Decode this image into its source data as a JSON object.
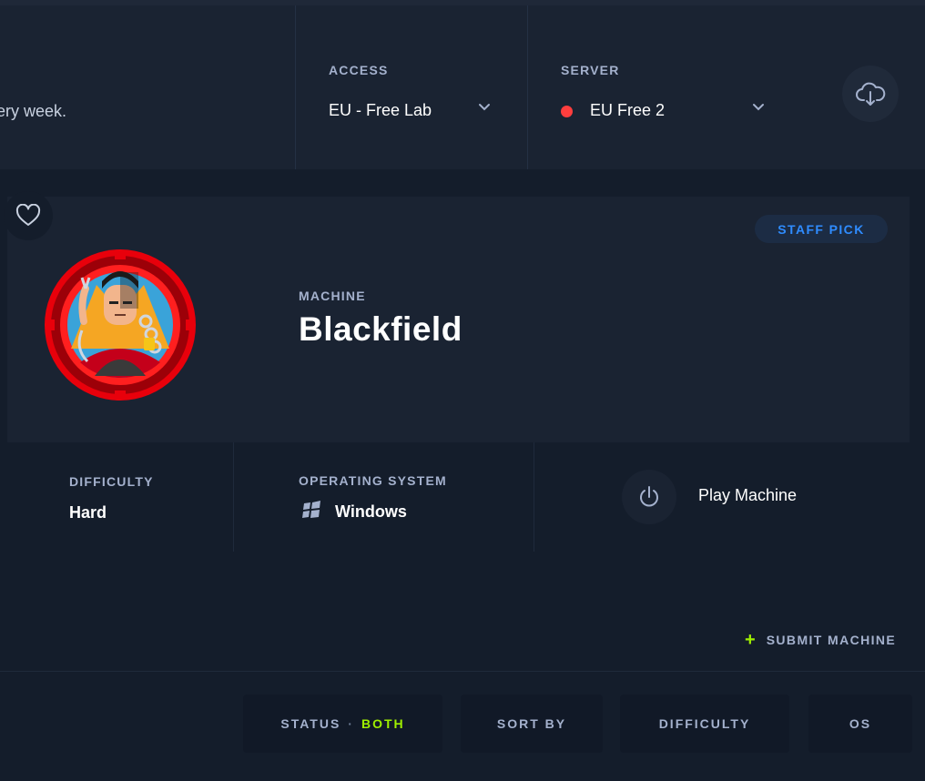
{
  "topbar": {
    "announcement": "ery week.",
    "access": {
      "label": "ACCESS",
      "value": "EU - Free Lab"
    },
    "server": {
      "label": "SERVER",
      "value": "EU Free 2",
      "status_color": "#ff3e3e"
    },
    "download_icon": "cloud-download-icon"
  },
  "machine": {
    "badge": "STAFF PICK",
    "label": "MACHINE",
    "name": "Blackfield",
    "favorite_icon": "heart-icon",
    "difficulty_label": "DIFFICULTY",
    "difficulty": "Hard",
    "os_label": "OPERATING SYSTEM",
    "os": "Windows",
    "os_icon": "windows-icon",
    "play_label": "Play Machine",
    "play_icon": "power-icon"
  },
  "actions": {
    "submit": "SUBMIT MACHINE"
  },
  "filters": {
    "status_label": "STATUS",
    "status_sep": "·",
    "status_value": "BOTH",
    "sort_by": "SORT BY",
    "difficulty": "DIFFICULTY",
    "os": "OS"
  },
  "colors": {
    "accent_green": "#9fef00",
    "accent_blue": "#2f8cff",
    "background": "#141d2b",
    "panel": "#1a2332"
  }
}
